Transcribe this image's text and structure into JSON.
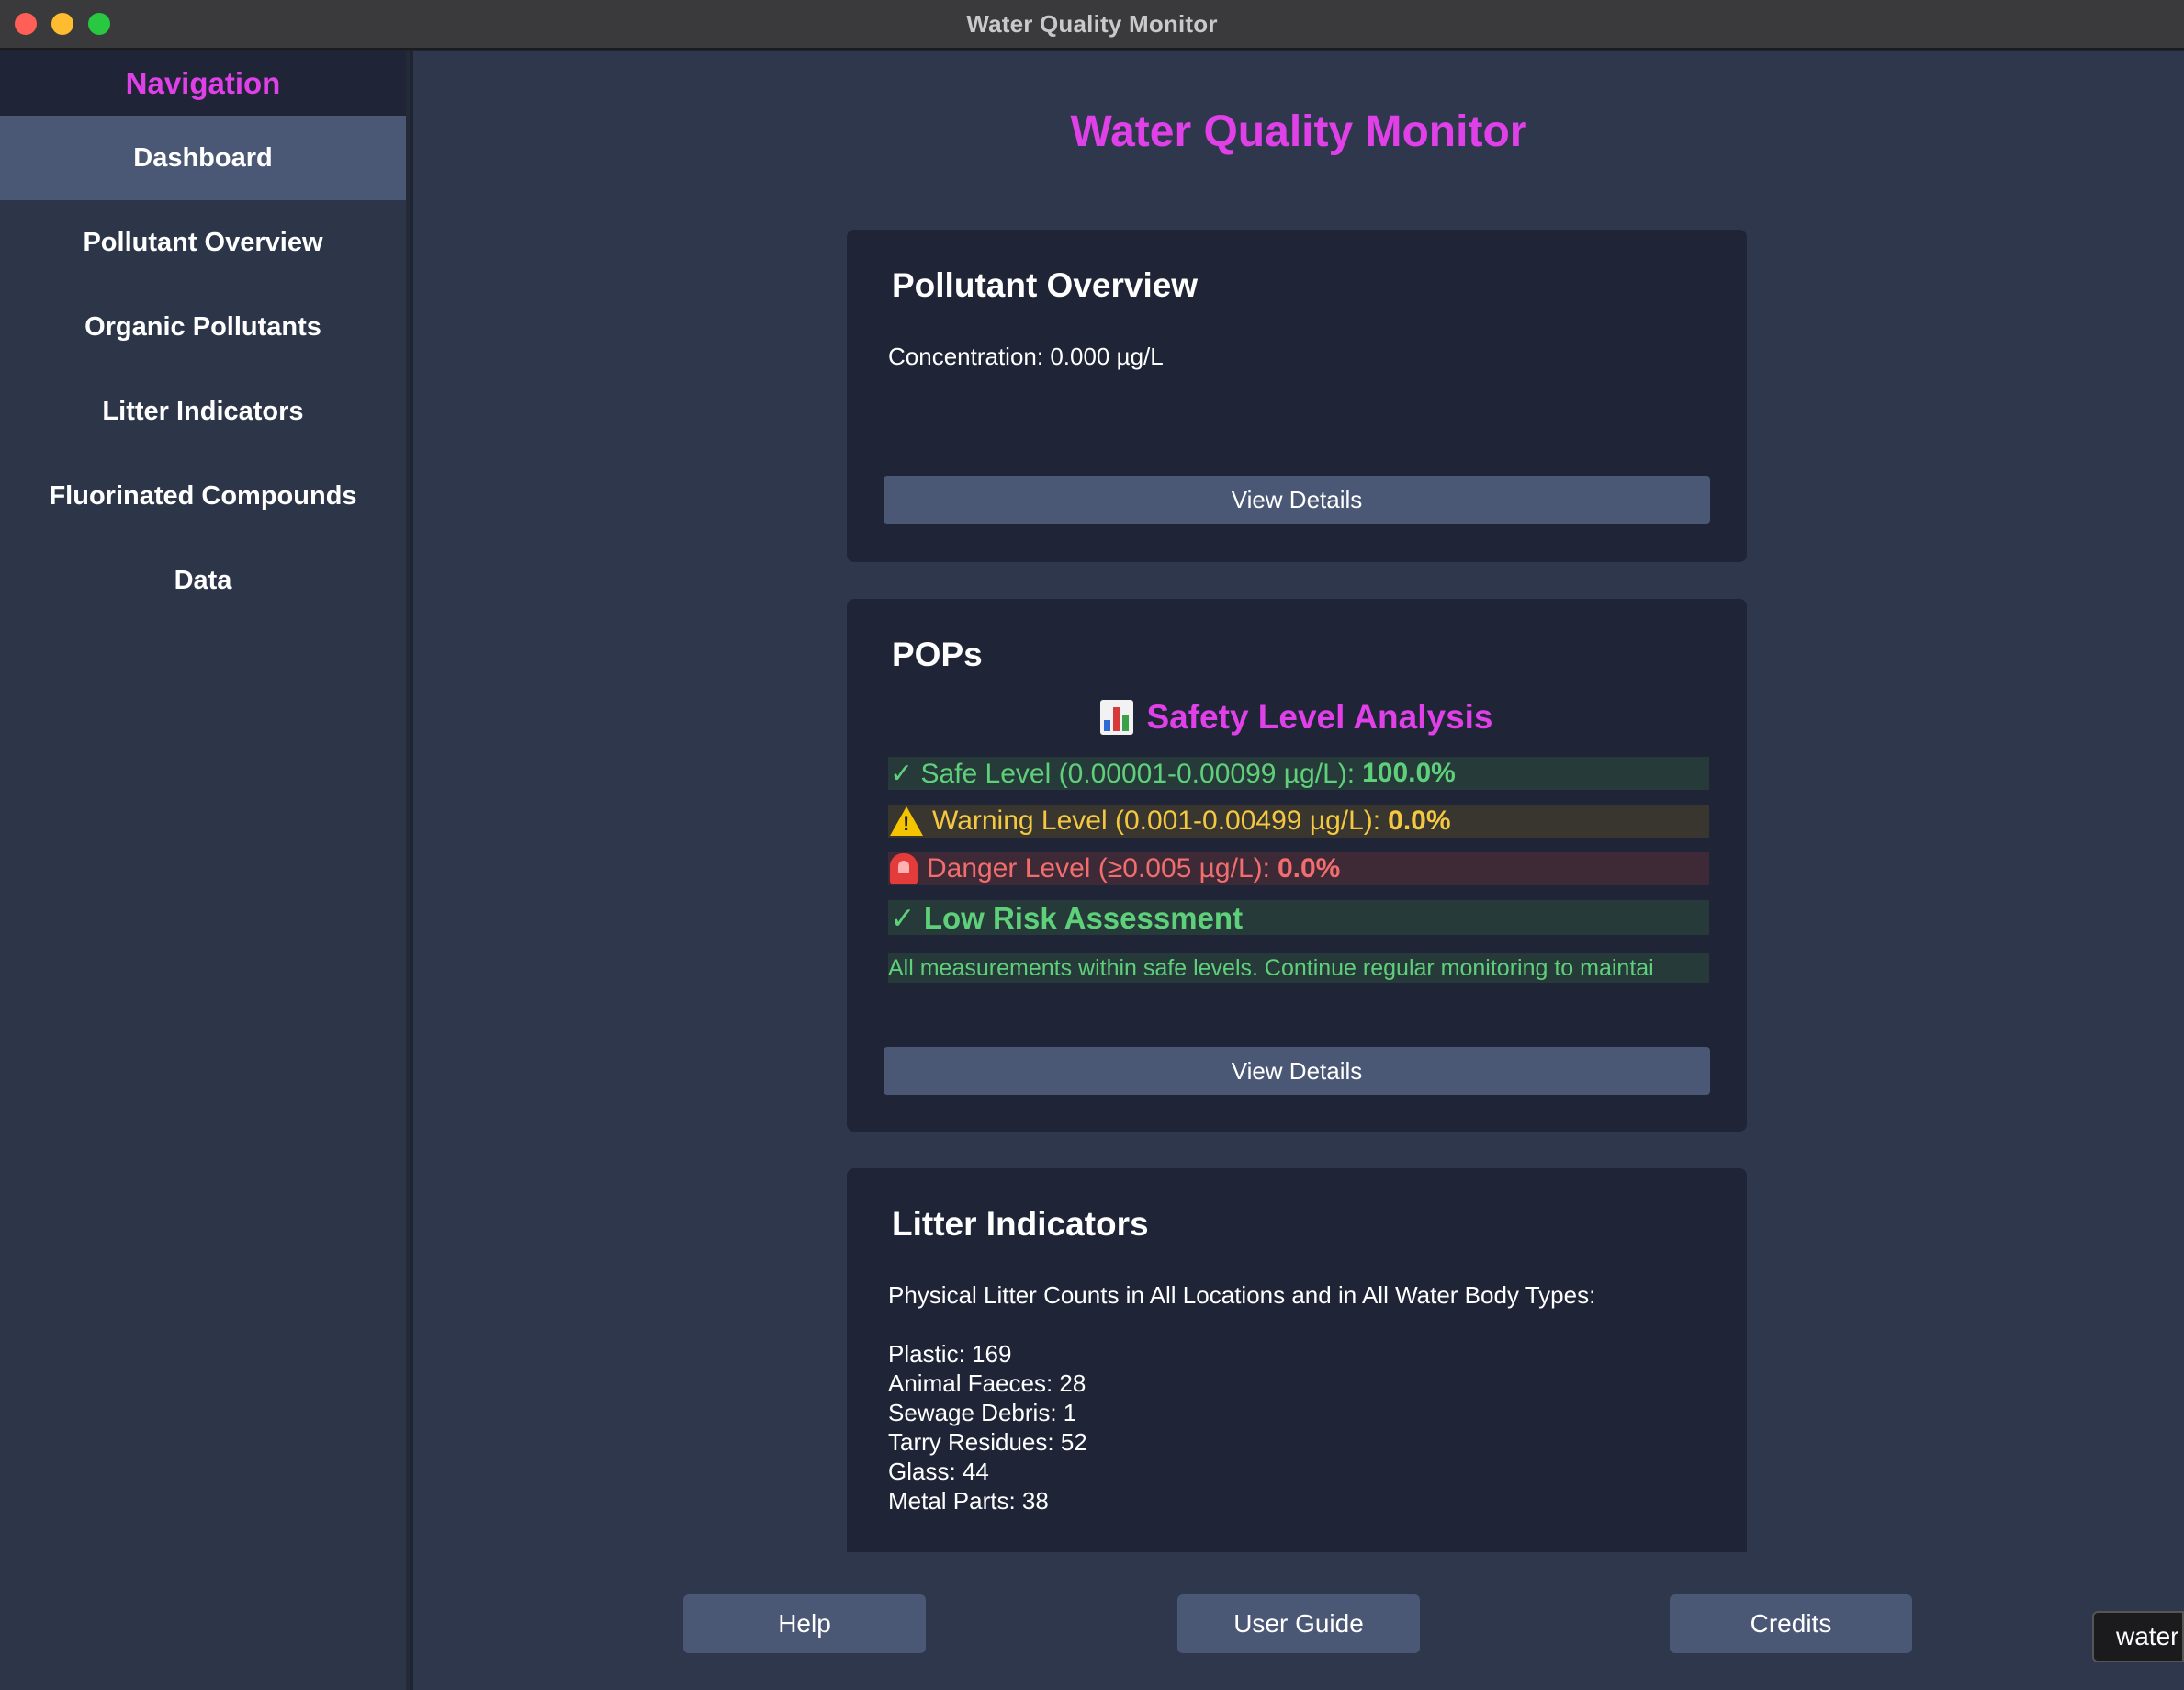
{
  "window": {
    "title": "Water Quality Monitor"
  },
  "sidebar": {
    "header": "Navigation",
    "items": [
      {
        "label": "Dashboard",
        "active": true
      },
      {
        "label": "Pollutant Overview"
      },
      {
        "label": "Organic Pollutants"
      },
      {
        "label": "Litter Indicators"
      },
      {
        "label": "Fluorinated Compounds"
      },
      {
        "label": "Data"
      }
    ]
  },
  "main": {
    "title": "Water Quality Monitor",
    "pollutant_card": {
      "title": "Pollutant Overview",
      "concentration": "Concentration: 0.000 µg/L",
      "button": "View Details"
    },
    "pops_card": {
      "title": "POPs",
      "analysis_title": "Safety Level Analysis",
      "safe": {
        "label": "✓ Safe Level (0.00001-0.00099 µg/L):",
        "value": "100.0%"
      },
      "warning": {
        "label": "Warning Level (0.001-0.00499 µg/L):",
        "value": "0.0%"
      },
      "danger": {
        "label": "Danger Level (≥0.005 µg/L):",
        "value": "0.0%"
      },
      "risk_title": "✓ Low Risk Assessment",
      "risk_note": "All measurements within safe levels. Continue regular monitoring to maintai",
      "button": "View Details"
    },
    "litter_card": {
      "title": "Litter Indicators",
      "intro": "Physical Litter Counts in All Locations and in All Water Body Types:",
      "items": [
        "Plastic: 169",
        "Animal Faeces: 28",
        "Sewage Debris: 1",
        "Tarry Residues: 52",
        "Glass: 44",
        "Metal Parts: 38"
      ]
    }
  },
  "footer": {
    "help": "Help",
    "user_guide": "User Guide",
    "credits": "Credits"
  },
  "tooltip": "water",
  "colors": {
    "accent": "#e040e8",
    "safe": "#5fd07a",
    "warning": "#f5c842",
    "danger": "#f26d6d",
    "button": "#4a5775"
  }
}
